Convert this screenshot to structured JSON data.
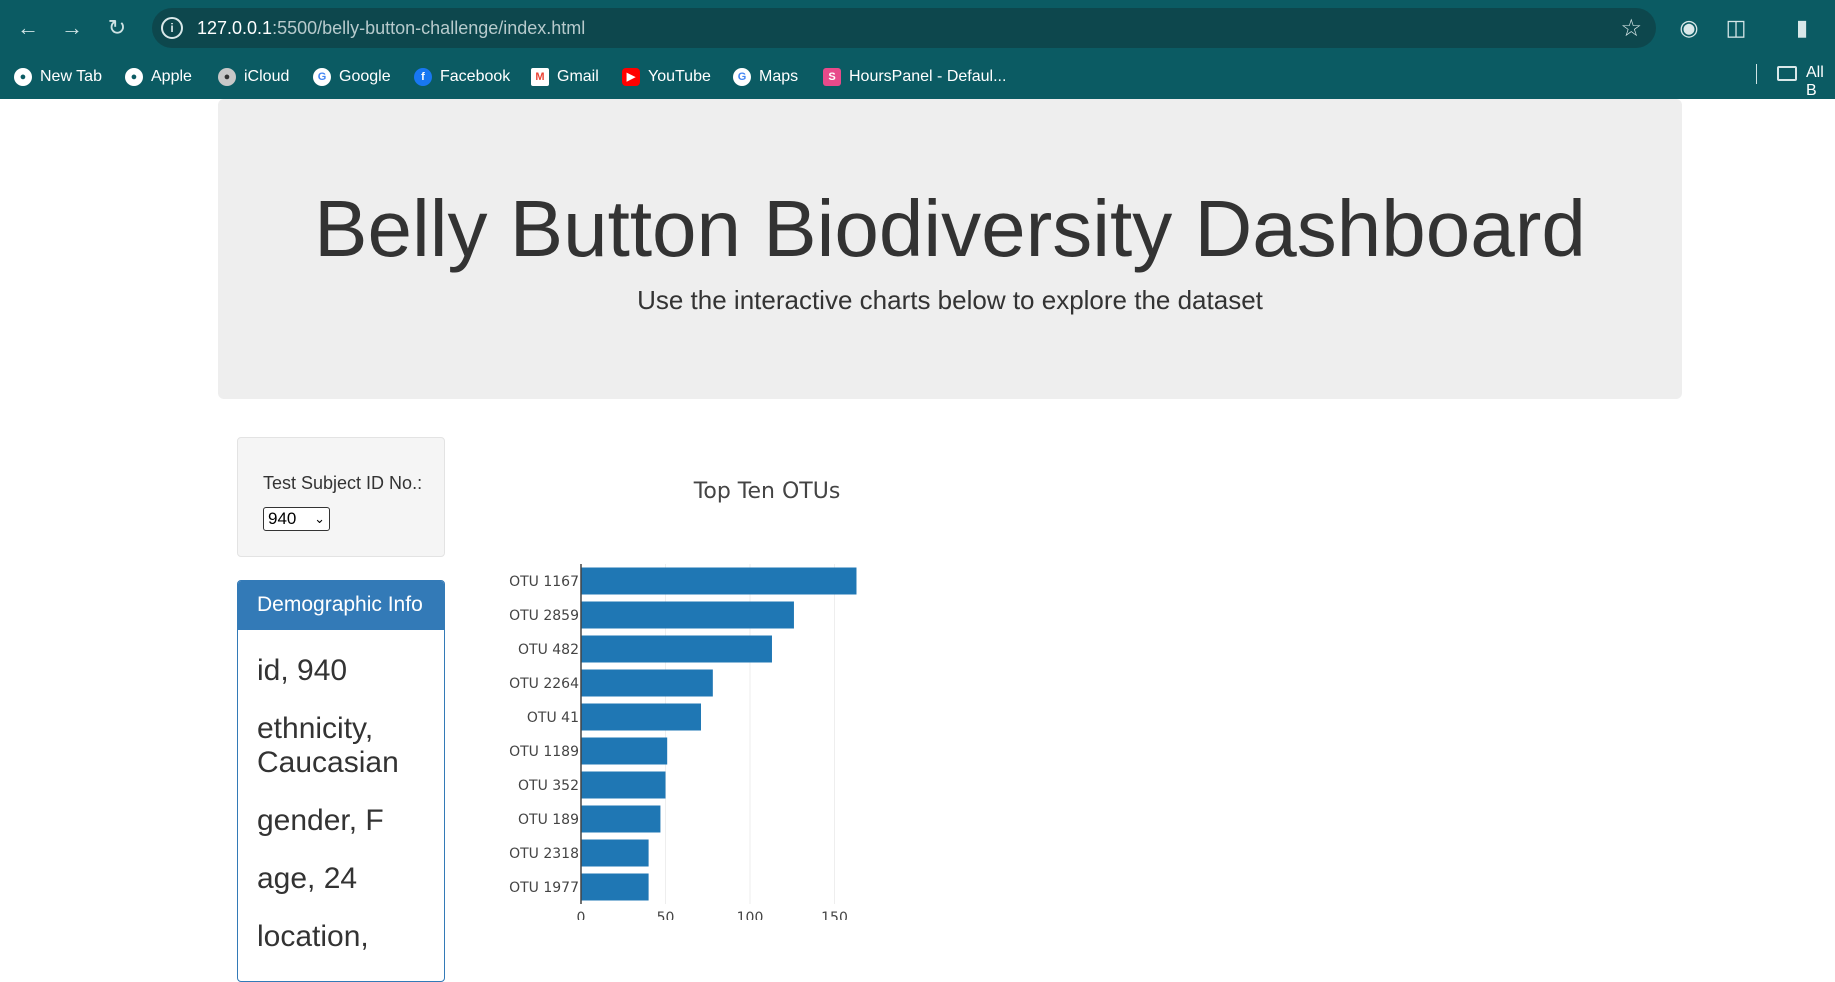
{
  "browser": {
    "url_host": "127.0.0.1",
    "url_path": ":5500/belly-button-challenge/index.html",
    "bookmarks": [
      "New Tab",
      "Apple",
      "iCloud",
      "Google",
      "Facebook",
      "Gmail",
      "YouTube",
      "Maps",
      "HoursPanel - Defaul..."
    ],
    "all_bookmarks_label": "All B"
  },
  "header": {
    "title": "Belly Button Biodiversity Dashboard",
    "subtitle": "Use the interactive charts below to explore the dataset"
  },
  "selector": {
    "label": "Test Subject ID No.:",
    "value": "940"
  },
  "demographics": {
    "heading": "Demographic Info",
    "items": [
      "id, 940",
      "ethnicity, Caucasian",
      "gender, F",
      "age, 24",
      "location,"
    ]
  },
  "chart_data": {
    "type": "bar",
    "orientation": "horizontal",
    "title": "Top Ten OTUs",
    "categories": [
      "OTU 1167",
      "OTU 2859",
      "OTU 482",
      "OTU 2264",
      "OTU 41",
      "OTU 1189",
      "OTU 352",
      "OTU 189",
      "OTU 2318",
      "OTU 1977"
    ],
    "values": [
      163,
      126,
      113,
      78,
      71,
      51,
      50,
      47,
      40,
      40
    ],
    "xticks": [
      0,
      50,
      100,
      150
    ],
    "xlim": [
      0,
      171
    ],
    "grid": true,
    "bar_color": "#1f77b4"
  }
}
